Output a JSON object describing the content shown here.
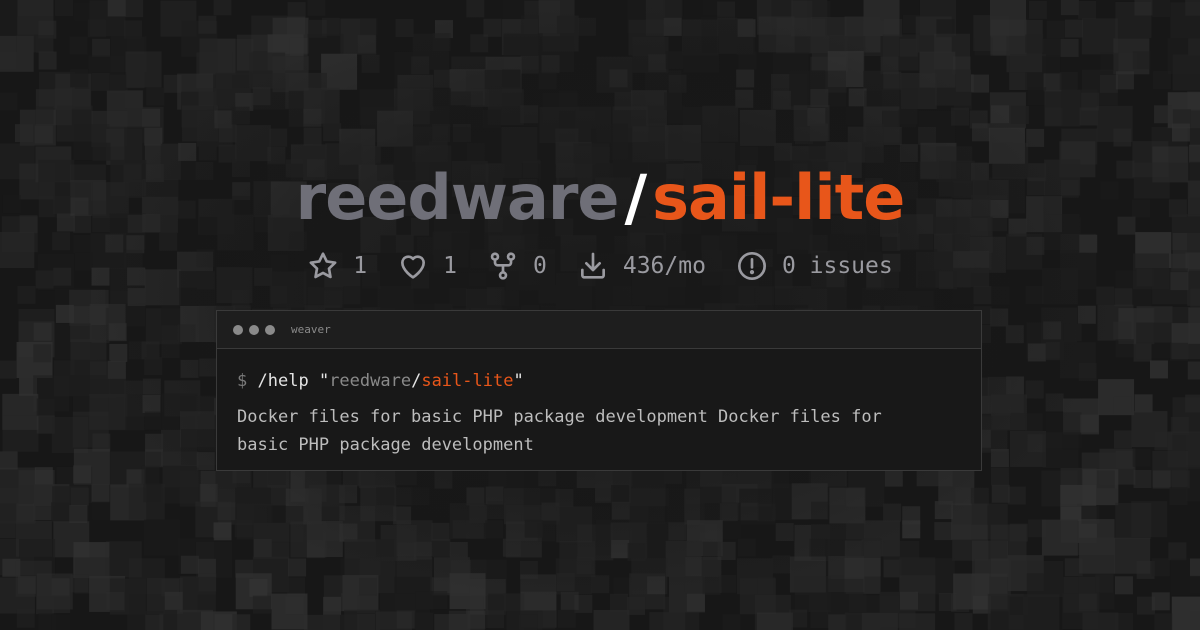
{
  "title": {
    "owner": "reedware",
    "separator": "/",
    "repo": "sail-lite"
  },
  "colors": {
    "accent": "#e8561a",
    "owner": "#6f6f78",
    "background": "#171717"
  },
  "stats": [
    {
      "icon": "star-icon",
      "value": "1"
    },
    {
      "icon": "heart-icon",
      "value": "1"
    },
    {
      "icon": "fork-icon",
      "value": "0"
    },
    {
      "icon": "download-icon",
      "value": "436/mo"
    },
    {
      "icon": "issue-icon",
      "value": "0 issues"
    }
  ],
  "terminal": {
    "title": "weaver",
    "prompt": "$",
    "command": "/help",
    "quote_open": "\"",
    "arg_owner": "reedware",
    "arg_sep": "/",
    "arg_repo": "sail-lite",
    "quote_close": "\"",
    "output": "Docker files for basic PHP package development Docker files for basic PHP package development"
  }
}
